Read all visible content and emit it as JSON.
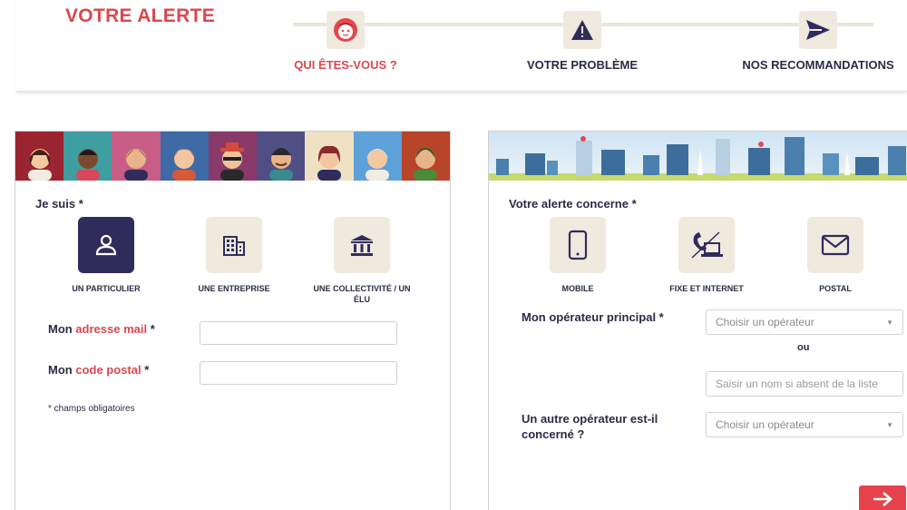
{
  "header": {
    "title": "VOTRE ALERTE",
    "steps": [
      {
        "label": "QUI ÊTES-VOUS ?",
        "icon": "face-icon",
        "active": true
      },
      {
        "label": "VOTRE PROBLÈME",
        "icon": "warning-icon",
        "active": false
      },
      {
        "label": "NOS RECOMMANDATIONS",
        "icon": "send-icon",
        "active": false
      }
    ]
  },
  "left": {
    "title": "Je suis *",
    "options": [
      {
        "label": "UN PARTICULIER",
        "icon": "person-icon",
        "selected": true
      },
      {
        "label": "UNE ENTREPRISE",
        "icon": "building-icon",
        "selected": false
      },
      {
        "label": "UNE COLLECTIVITÉ / UN ÉLU",
        "icon": "institution-icon",
        "selected": false
      }
    ],
    "email_label": {
      "prefix": "Mon ",
      "highlight": "adresse mail",
      "suffix": " *"
    },
    "postal_label": {
      "prefix": "Mon ",
      "highlight": "code postal",
      "suffix": " *"
    },
    "email_value": "",
    "postal_value": "",
    "note": "* champs obligatoires"
  },
  "right": {
    "title": "Votre alerte concerne *",
    "options": [
      {
        "label": "MOBILE",
        "icon": "mobile-icon",
        "selected": false
      },
      {
        "label": "FIXE ET INTERNET",
        "icon": "phone-laptop-icon",
        "selected": false
      },
      {
        "label": "POSTAL",
        "icon": "mail-icon",
        "selected": false
      }
    ],
    "operator_label": "Mon opérateur principal *",
    "operator_placeholder": "Choisir un opérateur",
    "or_label": "ou",
    "name_placeholder": "Saisir un nom si absent de la liste",
    "other_label_1": "Un autre opérateur est-il",
    "other_label_2": "concerné ?",
    "other_placeholder": "Choisir un opérateur"
  },
  "colors": {
    "accent": "#d9484f",
    "navy": "#2f2c5c",
    "tile": "#efe9de"
  }
}
